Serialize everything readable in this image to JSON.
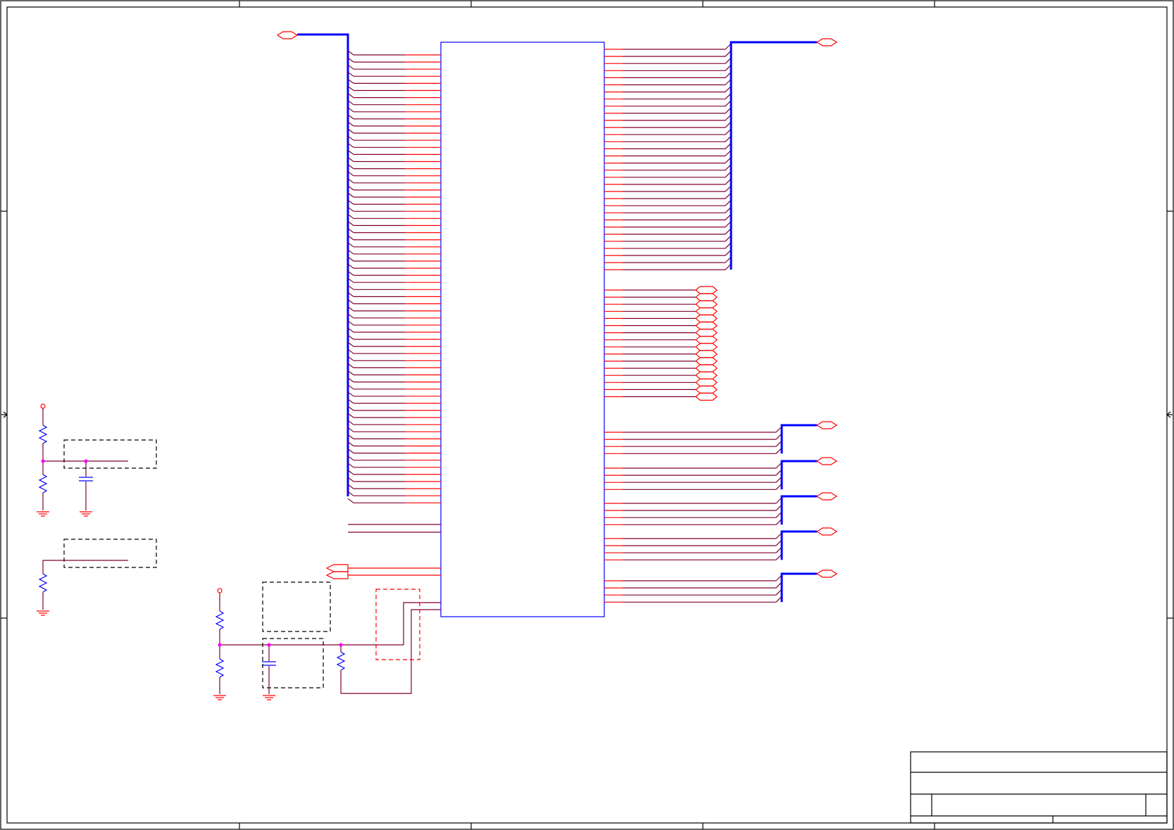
{
  "colors": {
    "wire": "#ff0000",
    "wire_dark": "#7f0030",
    "bus": "#0000ff",
    "component": "#0000ff",
    "junction": "#ff00ff",
    "frame": "#000000"
  },
  "schematic": {
    "ic_left_pin_count": 64,
    "ic_right_bus_pin_count": 32,
    "right_single_port_count": 16,
    "bus_groups_right": [
      4,
      4,
      4,
      4,
      4
    ]
  },
  "title_block": {
    "title": "",
    "size": "",
    "document_number": "",
    "rev": "",
    "date": "",
    "sheet": ""
  }
}
